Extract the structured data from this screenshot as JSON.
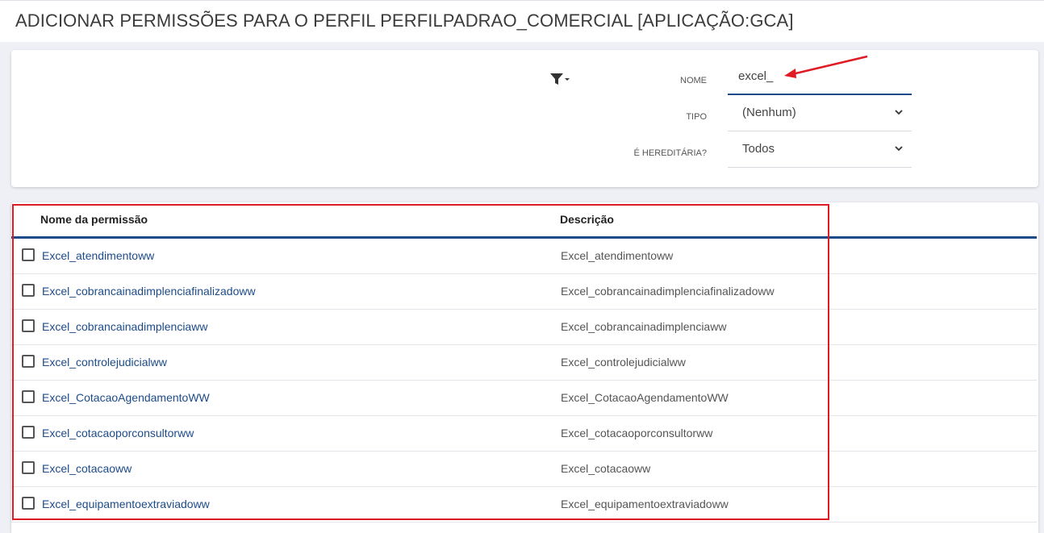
{
  "page": {
    "title": "ADICIONAR PERMISSÕES PARA O PERFIL PERFILPADRAO_COMERCIAL [APLICAÇÃO:GCA]"
  },
  "filters": {
    "filter_icon": "filter-funnel-icon",
    "nome": {
      "label": "NOME",
      "value": "excel_"
    },
    "tipo": {
      "label": "TIPO",
      "selected": "(Nenhum)"
    },
    "hereditaria": {
      "label": "É HEREDITÁRIA?",
      "selected": "Todos"
    }
  },
  "table": {
    "columns": {
      "name": "Nome da permissão",
      "description": "Descrição"
    },
    "rows": [
      {
        "name": "Excel_atendimentoww",
        "description": "Excel_atendimentoww"
      },
      {
        "name": "Excel_cobrancainadimplenciafinalizadoww",
        "description": "Excel_cobrancainadimplenciafinalizadoww"
      },
      {
        "name": "Excel_cobrancainadimplenciaww",
        "description": "Excel_cobrancainadimplenciaww"
      },
      {
        "name": "Excel_controlejudicialww",
        "description": "Excel_controlejudicialww"
      },
      {
        "name": "Excel_CotacaoAgendamentoWW",
        "description": "Excel_CotacaoAgendamentoWW"
      },
      {
        "name": "Excel_cotacaoporconsultorww",
        "description": "Excel_cotacaoporconsultorww"
      },
      {
        "name": "Excel_cotacaoww",
        "description": "Excel_cotacaoww"
      },
      {
        "name": "Excel_equipamentoextraviadoww",
        "description": "Excel_equipamentoextraviadoww"
      }
    ]
  },
  "colors": {
    "accent": "#1d4b8a",
    "annotation": "#e01b24"
  }
}
